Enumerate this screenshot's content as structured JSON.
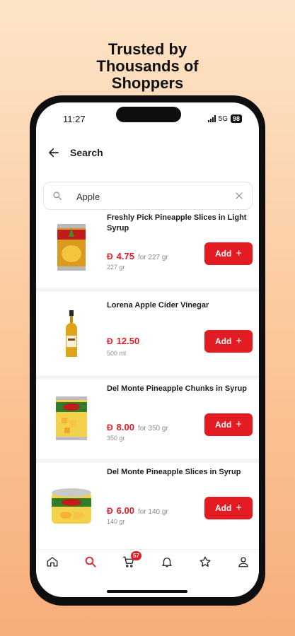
{
  "promo": {
    "headline": "Trusted by\nThousands of\nShoppers"
  },
  "status_bar": {
    "time": "11:27",
    "network": "5G",
    "battery": "98"
  },
  "header": {
    "title": "Search"
  },
  "search": {
    "value": "Apple"
  },
  "products": [
    {
      "name": "Freshly Pick Pineapple Slices in Light Syrup",
      "currency": "Ð",
      "price": "4.75",
      "per": "for 227 gr",
      "size": "227 gr",
      "add_label": "Add"
    },
    {
      "name": "Lorena Apple Cider Vinegar",
      "currency": "Ð",
      "price": "12.50",
      "per": "",
      "size": "500 ml",
      "add_label": "Add"
    },
    {
      "name": "Del Monte Pineapple Chunks in Syrup",
      "currency": "Ð",
      "price": "8.00",
      "per": "for 350 gr",
      "size": "350 gr",
      "add_label": "Add"
    },
    {
      "name": "Del Monte Pineapple Slices in Syrup",
      "currency": "Ð",
      "price": "6.00",
      "per": "for 140 gr",
      "size": "140 gr",
      "add_label": "Add"
    }
  ],
  "nav": {
    "cart_count": "57"
  },
  "colors": {
    "accent": "#e31b23",
    "background_top": "#fde4c8",
    "background_bottom": "#f7ad7a"
  }
}
